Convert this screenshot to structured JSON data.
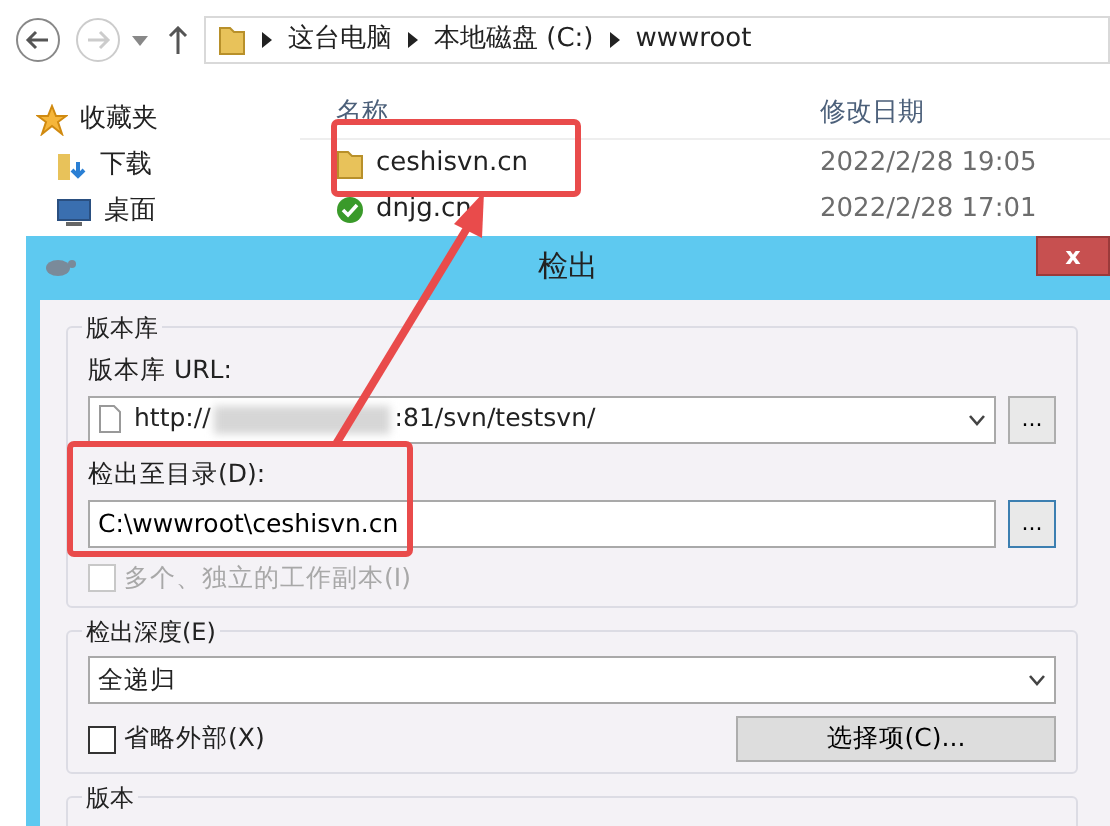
{
  "explorer": {
    "address": [
      "这台电脑",
      "本地磁盘 (C:)",
      "wwwroot"
    ],
    "sidebar": [
      {
        "label": "收藏夹",
        "kind": "star"
      },
      {
        "label": "下载",
        "kind": "download"
      },
      {
        "label": "桌面",
        "kind": "desktop"
      }
    ],
    "columns": [
      "名称",
      "修改日期"
    ],
    "files": [
      {
        "name": "ceshisvn.cn",
        "date": "2022/2/28 19:05",
        "kind": "folder"
      },
      {
        "name": "dnjg.cn",
        "date": "2022/2/28 17:01",
        "kind": "svn"
      }
    ]
  },
  "dialog": {
    "title": "检出",
    "close_button": "x",
    "browse_button": "...",
    "repo_group": {
      "legend": "版本库",
      "url_label": "版本库 URL:",
      "url_prefix": "http://",
      "url_suffix": ":81/svn/testsvn/",
      "dir_label": "检出至目录(D):",
      "dir_value": "C:\\wwwroot\\ceshisvn.cn",
      "multi_checkbox": {
        "label": "多个、独立的工作副本(I)",
        "checked": false,
        "disabled": true
      }
    },
    "depth_group": {
      "legend": "检出深度(E)",
      "depth_value": "全递归",
      "omit_checkbox": {
        "label": "省略外部(X)",
        "checked": false,
        "disabled": false
      },
      "options_button": "选择项(C)..."
    },
    "revision_group": {
      "legend": "版本"
    }
  }
}
